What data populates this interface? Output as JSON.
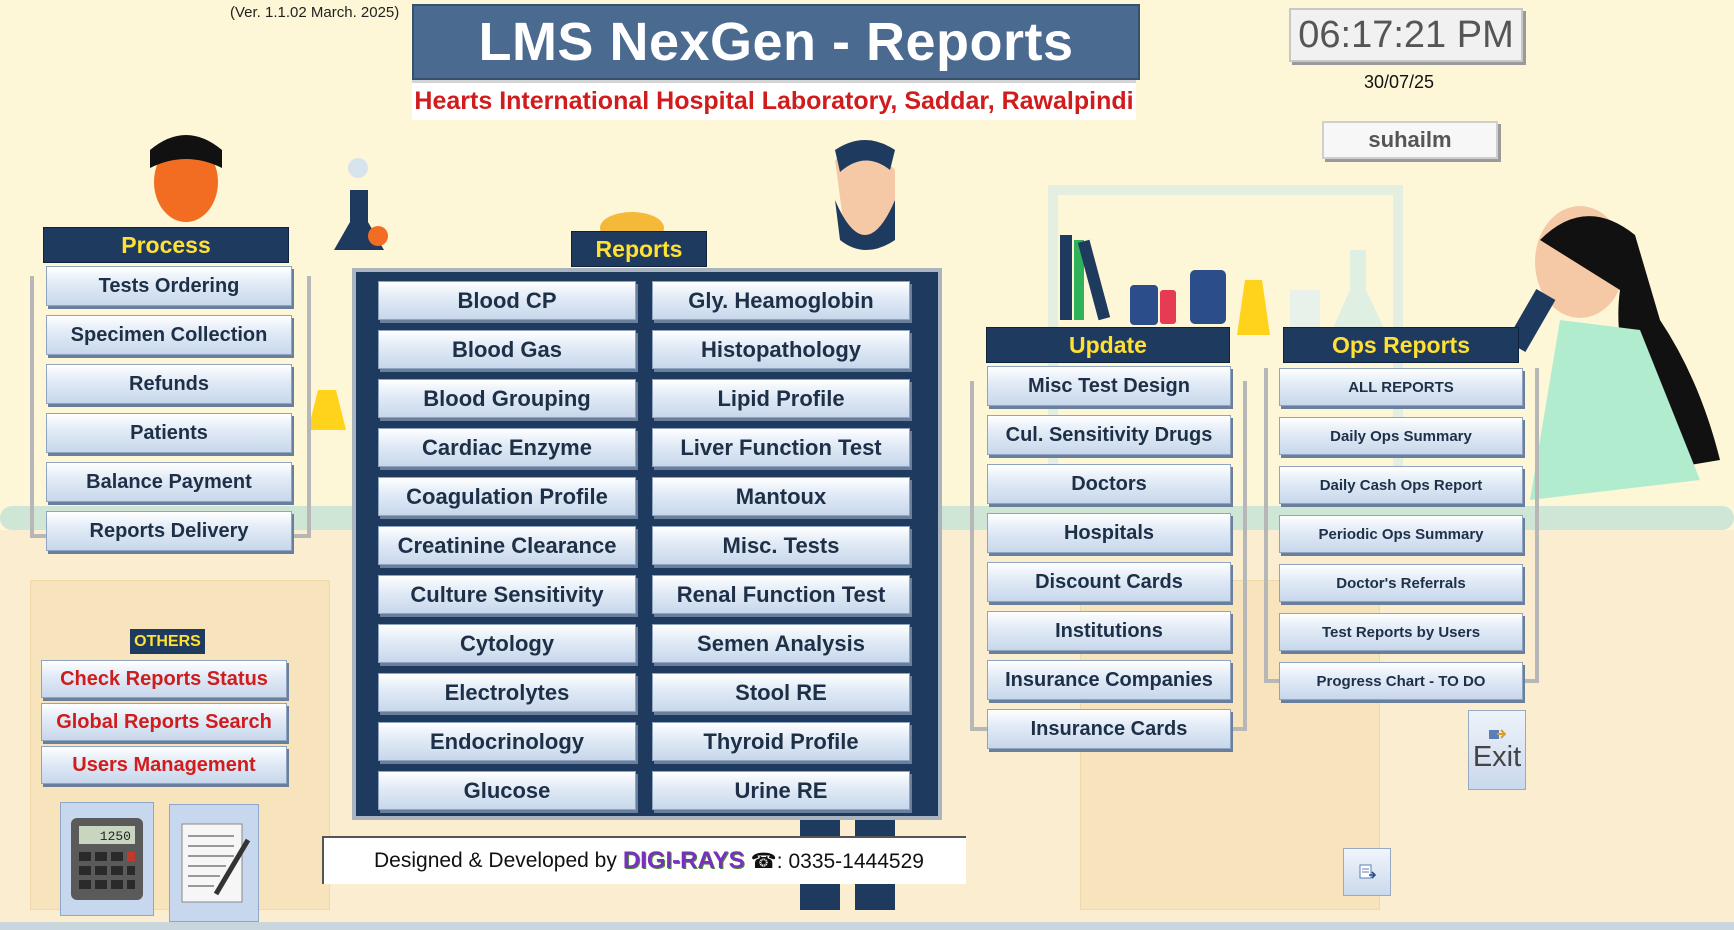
{
  "header": {
    "version": "(Ver. 1.1.02 March. 2025)",
    "title": "LMS NexGen - Reports",
    "subtitle": "Hearts International Hospital Laboratory, Saddar, Rawalpindi",
    "time": "06:17:21 PM",
    "date": "30/07/25",
    "user": "suhailm"
  },
  "process": {
    "header": "Process",
    "items": [
      "Tests Ordering",
      "Specimen Collection",
      "Refunds",
      "Patients",
      "Balance Payment",
      "Reports Delivery"
    ]
  },
  "reports": {
    "header": "Reports",
    "left": [
      "Blood CP",
      "Blood Gas",
      "Blood Grouping",
      "Cardiac Enzyme",
      "Coagulation Profile",
      "Creatinine Clearance",
      "Culture Sensitivity",
      "Cytology",
      "Electrolytes",
      "Endocrinology",
      "Glucose"
    ],
    "right": [
      "Gly. Heamoglobin",
      "Histopathology",
      "Lipid Profile",
      "Liver Function Test",
      "Mantoux",
      "Misc. Tests",
      "Renal Function Test",
      "Semen Analysis",
      "Stool RE",
      "Thyroid Profile",
      "Urine RE"
    ]
  },
  "update": {
    "header": "Update",
    "items": [
      "Misc Test Design",
      "Cul. Sensitivity Drugs",
      "Doctors",
      "Hospitals",
      "Discount Cards",
      "Institutions",
      "Insurance Companies",
      "Insurance Cards"
    ]
  },
  "ops": {
    "header": "Ops Reports",
    "items": [
      "ALL REPORTS",
      "Daily Ops Summary",
      "Daily Cash Ops Report",
      "Periodic Ops Summary",
      "Doctor's Referrals",
      "Test Reports by Users",
      "Progress Chart - TO DO"
    ]
  },
  "others": {
    "header": "OTHERS",
    "items": [
      "Check Reports Status",
      "Global Reports Search",
      "Users Management"
    ]
  },
  "footer": {
    "prefix": "Designed & Developed by",
    "brand": "DIGI-RAYS",
    "phone": "☎: 0335-1444529"
  },
  "exit": {
    "label": "Exit"
  },
  "calculator": {
    "display": "1250"
  },
  "icons": {
    "calculator": "calculator-icon",
    "notepad": "notepad-icon",
    "exit": "exit-icon",
    "small": "small-report-icon"
  },
  "colors": {
    "background": "#fdf7d8",
    "header_navy": "#1f3a5f",
    "header_text": "#ffe033",
    "title_bg": "#4a6a90",
    "subtitle_red": "#d01c1c",
    "brand_purple": "#7b2fbe"
  }
}
